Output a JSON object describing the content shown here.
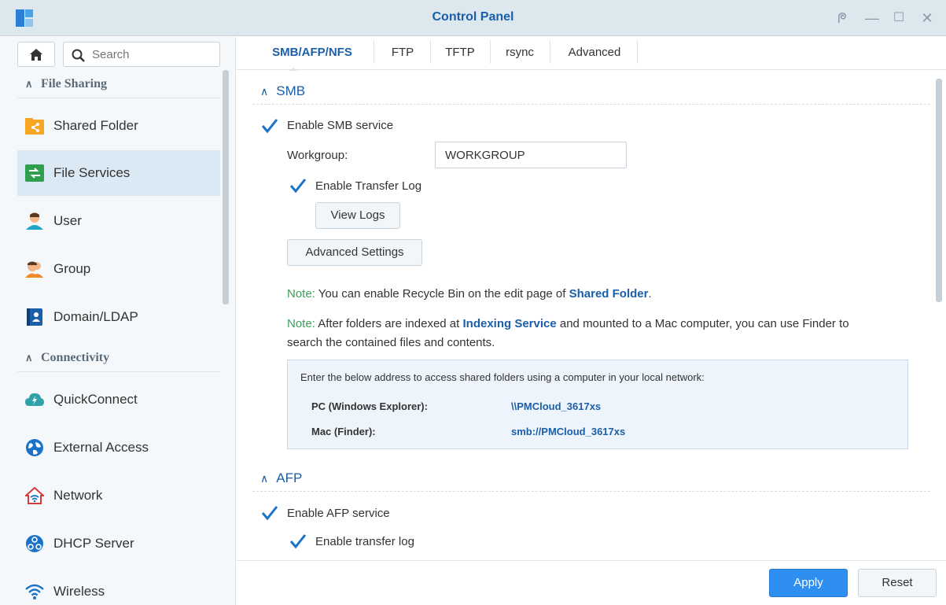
{
  "window": {
    "title": "Control Panel",
    "controls": {
      "pin": "ᖘ",
      "minimize": "—",
      "maximize": "☐",
      "close": "✕"
    }
  },
  "sidebar": {
    "search_placeholder": "Search",
    "sections": [
      {
        "label": "File Sharing",
        "items": [
          {
            "label": "Shared Folder",
            "icon": "shared-folder-icon",
            "active": false
          },
          {
            "label": "File Services",
            "icon": "file-services-icon",
            "active": true
          },
          {
            "label": "User",
            "icon": "user-icon",
            "active": false
          },
          {
            "label": "Group",
            "icon": "group-icon",
            "active": false
          },
          {
            "label": "Domain/LDAP",
            "icon": "domain-ldap-icon",
            "active": false
          }
        ]
      },
      {
        "label": "Connectivity",
        "items": [
          {
            "label": "QuickConnect",
            "icon": "quickconnect-icon",
            "active": false
          },
          {
            "label": "External Access",
            "icon": "external-access-icon",
            "active": false
          },
          {
            "label": "Network",
            "icon": "network-icon",
            "active": false
          },
          {
            "label": "DHCP Server",
            "icon": "dhcp-server-icon",
            "active": false
          },
          {
            "label": "Wireless",
            "icon": "wireless-icon",
            "active": false
          }
        ]
      }
    ]
  },
  "tabs": [
    {
      "label": "SMB/AFP/NFS",
      "active": true
    },
    {
      "label": "FTP",
      "active": false
    },
    {
      "label": "TFTP",
      "active": false
    },
    {
      "label": "rsync",
      "active": false
    },
    {
      "label": "Advanced",
      "active": false
    }
  ],
  "smb": {
    "header": "SMB",
    "enable_label": "Enable SMB service",
    "enabled": true,
    "workgroup_label": "Workgroup:",
    "workgroup_value": "WORKGROUP",
    "transfer_log_label": "Enable Transfer Log",
    "transfer_log_enabled": true,
    "view_logs_label": "View Logs",
    "advanced_settings_label": "Advanced Settings",
    "note1": {
      "prefix": "Note:",
      "text": " You can enable Recycle Bin on the edit page of ",
      "link": "Shared Folder",
      "suffix": "."
    },
    "note2": {
      "prefix": "Note:",
      "text": " After folders are indexed at ",
      "link": "Indexing Service",
      "text2": " and mounted to a Mac computer, you can use Finder to",
      "line2": "search the contained files and contents."
    },
    "address_box": {
      "intro": "Enter the below address to access shared folders using a computer in your local network:",
      "rows": [
        {
          "key": "PC (Windows Explorer):",
          "value": "\\\\PMCloud_3617xs"
        },
        {
          "key": "Mac (Finder):",
          "value": "smb://PMCloud_3617xs"
        }
      ]
    }
  },
  "afp": {
    "header": "AFP",
    "enable_label": "Enable AFP service",
    "enabled": true,
    "transfer_log_label": "Enable transfer log",
    "transfer_log_enabled": true
  },
  "footer": {
    "apply_label": "Apply",
    "reset_label": "Reset"
  },
  "colors": {
    "accent": "#1a5fa8",
    "apply_button": "#2f8ff0",
    "note_prefix": "#3aa157",
    "active_nav": "#dbe9f5"
  }
}
